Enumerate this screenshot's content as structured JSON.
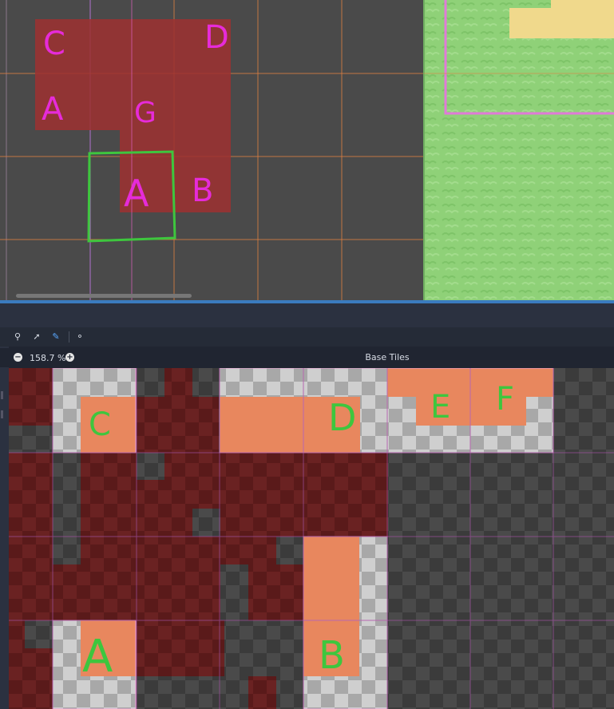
{
  "editor": {
    "zoom_level": "158.7 %",
    "atlas_title": "Base Tiles"
  },
  "viewport_annotations": [
    "C",
    "D",
    "A",
    "G",
    "A",
    "B"
  ],
  "atlas_annotations": [
    "C",
    "D",
    "E",
    "F",
    "A",
    "B"
  ],
  "toolbar": {
    "tools": [
      "terrain-tool-icon",
      "select-icon",
      "paint-icon",
      "picker-icon"
    ],
    "zoom_out": "−",
    "zoom_in": "+"
  },
  "colors": {
    "terrain_red": "#9e3030",
    "terrain_orange": "#e8875e",
    "annotation_magenta": "#e62bd9",
    "annotation_green": "#3ec63e",
    "grass": "#8fd178",
    "sand": "#f0d98c"
  }
}
